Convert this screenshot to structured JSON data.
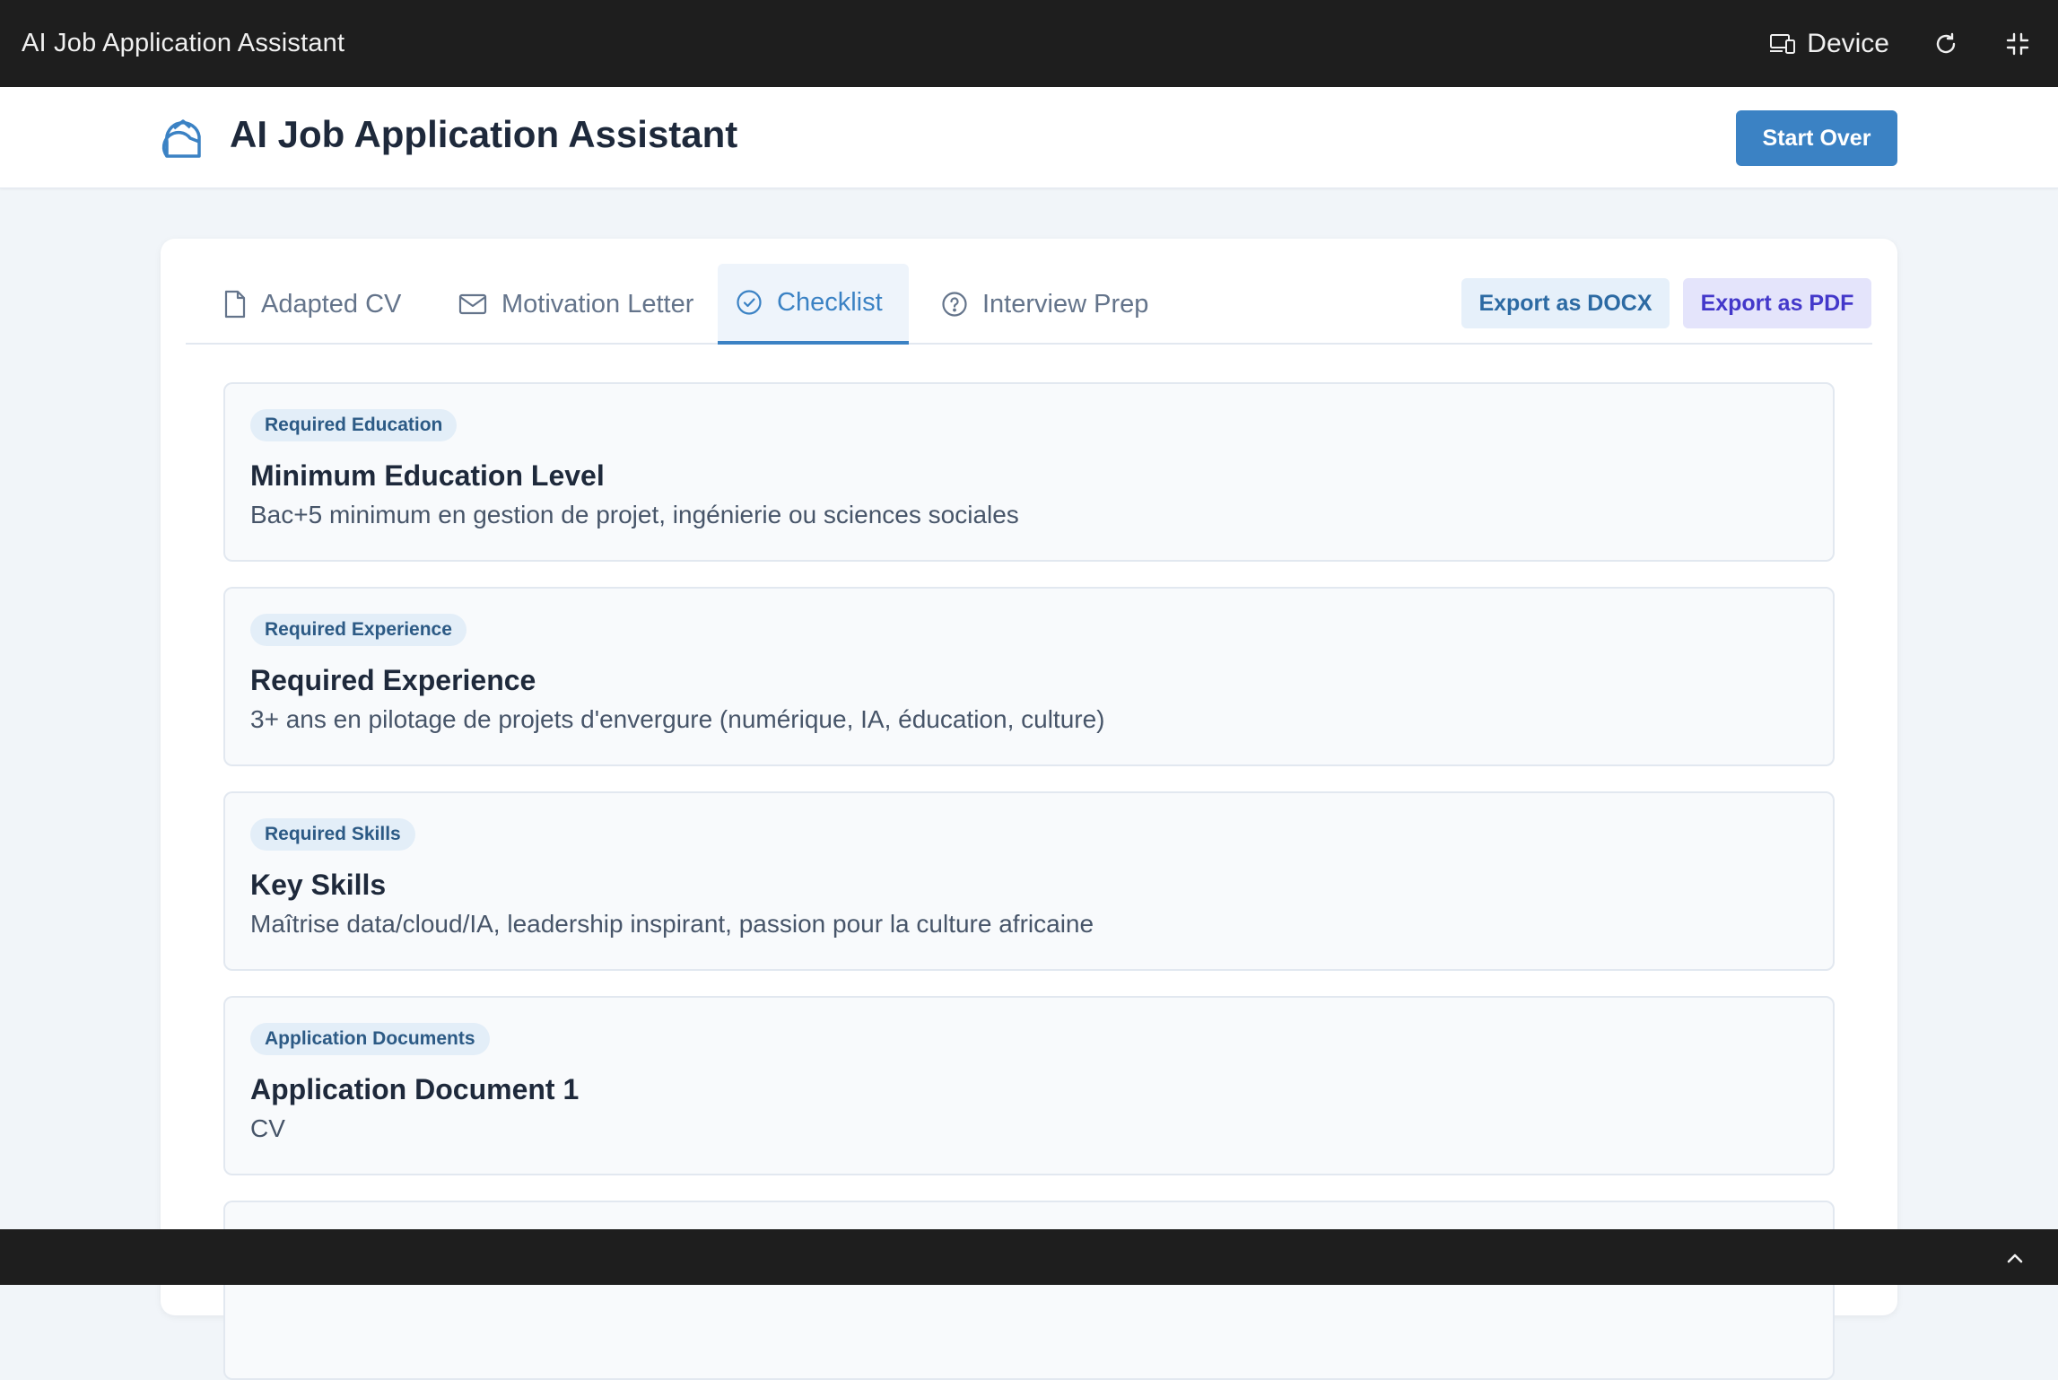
{
  "topbar": {
    "title": "AI Job Application Assistant",
    "device_label": "Device"
  },
  "header": {
    "title": "AI Job Application Assistant",
    "start_over_label": "Start Over"
  },
  "tabs": [
    {
      "label": "Adapted CV",
      "icon": "file-icon",
      "active": false
    },
    {
      "label": "Motivation Letter",
      "icon": "mail-icon",
      "active": false
    },
    {
      "label": "Checklist",
      "icon": "check-circle-icon",
      "active": true
    },
    {
      "label": "Interview Prep",
      "icon": "question-circle-icon",
      "active": false
    }
  ],
  "export": {
    "docx_label": "Export as DOCX",
    "pdf_label": "Export as PDF"
  },
  "checklist": [
    {
      "category": "Required Education",
      "title": "Minimum Education Level",
      "description": "Bac+5 minimum en gestion de projet, ingénierie ou sciences sociales"
    },
    {
      "category": "Required Experience",
      "title": "Required Experience",
      "description": "3+ ans en pilotage de projets d'envergure (numérique, IA, éducation, culture)"
    },
    {
      "category": "Required Skills",
      "title": "Key Skills",
      "description": "Maîtrise data/cloud/IA, leadership inspirant, passion pour la culture africaine"
    },
    {
      "category": "Application Documents",
      "title": "Application Document 1",
      "description": "CV"
    }
  ],
  "colors": {
    "accent": "#3b82c4",
    "topbar_bg": "#1e1e1e",
    "page_bg": "#f1f5f9"
  }
}
